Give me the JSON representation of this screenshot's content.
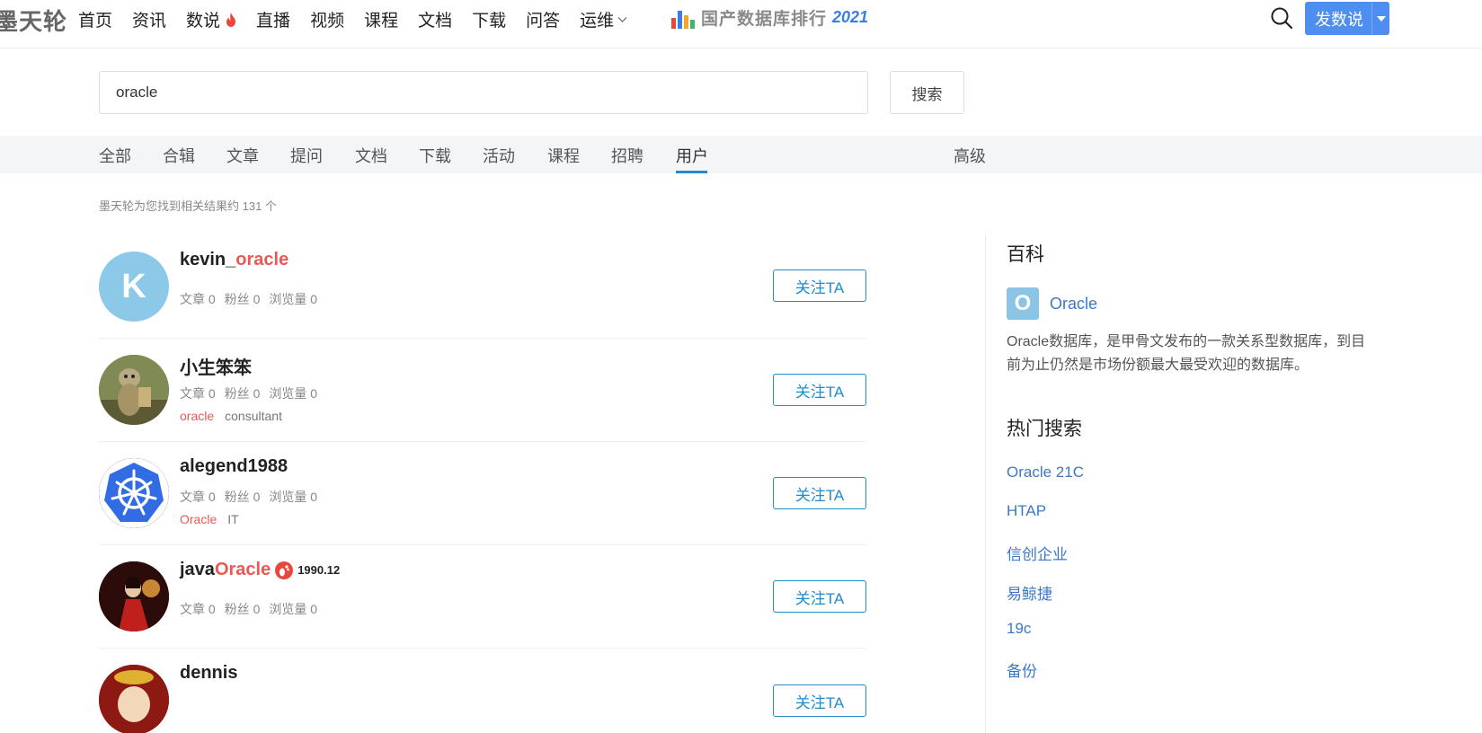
{
  "nav": {
    "logo": "墨天轮",
    "items": [
      "首页",
      "资讯",
      "数说",
      "直播",
      "视频",
      "课程",
      "文档",
      "下载",
      "问答",
      "运维"
    ],
    "banner_text": "国产数据库排行",
    "banner_year": "2021",
    "post_button": "发数说"
  },
  "search": {
    "value": "oracle",
    "button": "搜索"
  },
  "tabs": {
    "items": [
      "全部",
      "合辑",
      "文章",
      "提问",
      "文档",
      "下载",
      "活动",
      "课程",
      "招聘",
      "用户"
    ],
    "active": "用户",
    "advanced": "高级"
  },
  "result_count": "墨天轮为您找到相关结果约 131 个",
  "users": [
    {
      "name_prefix": "kevin_",
      "name_highlight": "oracle",
      "name_suffix": "",
      "avatar_letter": "K",
      "stats": [
        "文章 0",
        "粉丝 0",
        "浏览量 0"
      ],
      "tag_highlight": "",
      "tag": "",
      "badge": "",
      "follow": "关注TA"
    },
    {
      "name_prefix": "小生笨笨",
      "name_highlight": "",
      "name_suffix": "",
      "avatar_letter": "",
      "stats": [
        "文章 0",
        "粉丝 0",
        "浏览量 0"
      ],
      "tag_highlight": "oracle",
      "tag": "consultant",
      "badge": "",
      "follow": "关注TA"
    },
    {
      "name_prefix": "alegend1988",
      "name_highlight": "",
      "name_suffix": "",
      "avatar_letter": "",
      "stats": [
        "文章 0",
        "粉丝 0",
        "浏览量 0"
      ],
      "tag_highlight": "Oracle",
      "tag": "IT",
      "badge": "",
      "follow": "关注TA"
    },
    {
      "name_prefix": "java",
      "name_highlight": "Oracle",
      "name_suffix": "",
      "avatar_letter": "",
      "stats": [
        "文章 0",
        "粉丝 0",
        "浏览量 0"
      ],
      "tag_highlight": "",
      "tag": "",
      "badge": "1990.12",
      "follow": "关注TA"
    },
    {
      "name_prefix": "dennis",
      "name_highlight": "",
      "name_suffix": "",
      "avatar_letter": "",
      "stats": [],
      "tag_highlight": "",
      "tag": "",
      "badge": "",
      "follow": "关注TA"
    }
  ],
  "sidebar": {
    "wiki_title": "百科",
    "wiki_icon_letter": "O",
    "wiki_link": "Oracle",
    "wiki_desc": "Oracle数据库，是甲骨文发布的一款关系型数据库，到目前为止仍然是市场份额最大最受欢迎的数据库。",
    "hot_title": "热门搜索",
    "hot_items": [
      "Oracle 21C",
      "HTAP",
      "信创企业",
      "易鲸捷",
      "19c",
      "备份"
    ]
  },
  "colors": {
    "accent": "#1f8ccf",
    "highlight": "#e95a57",
    "primary_button": "#4d8ef0",
    "link": "#3c78c8"
  }
}
